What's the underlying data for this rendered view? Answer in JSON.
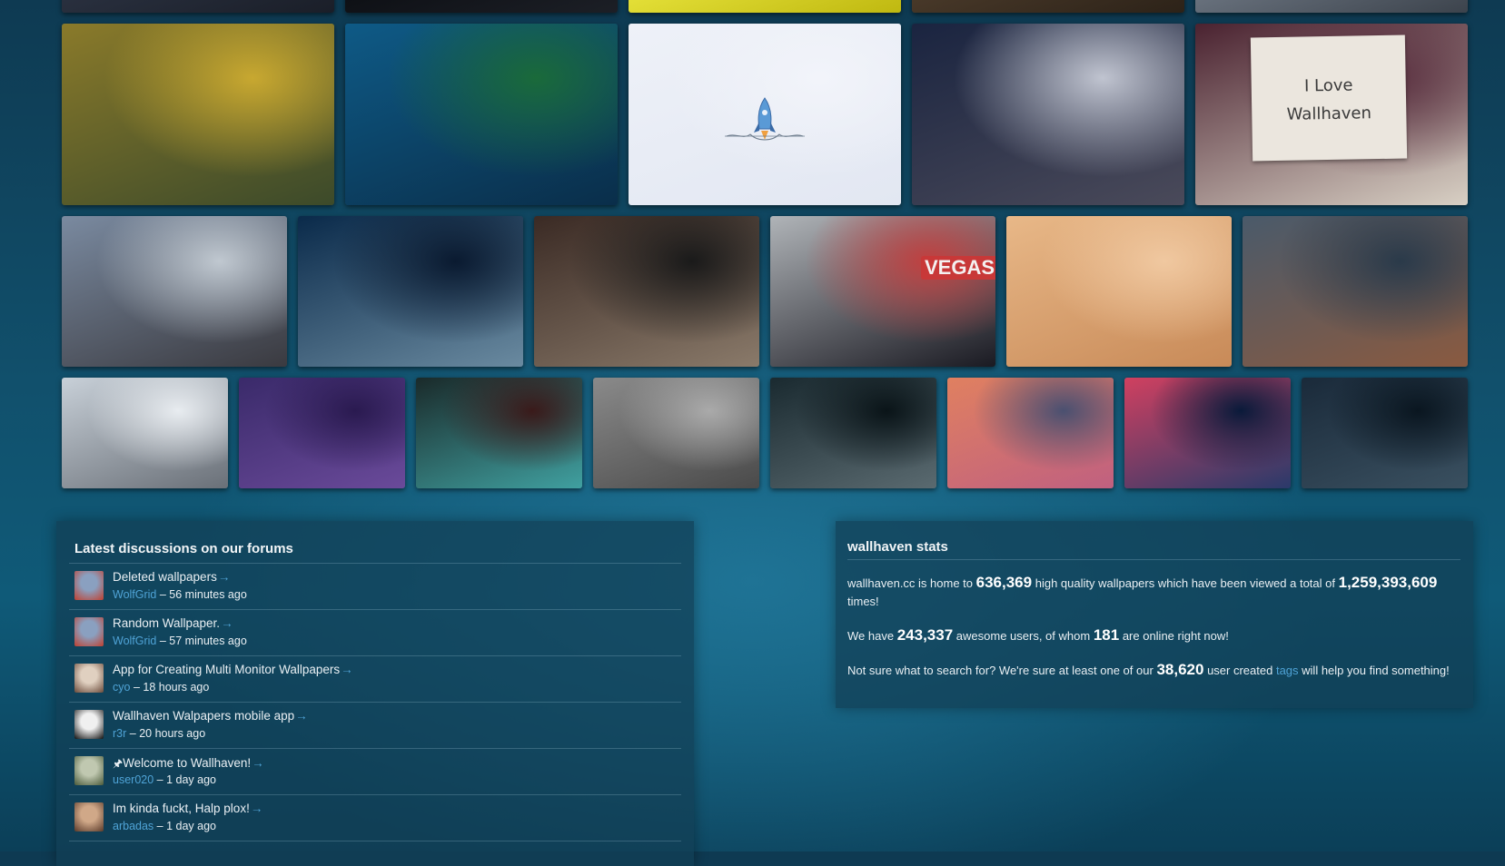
{
  "thumbnails": [
    {
      "name": "wallpaper-thumb-top-1",
      "colors": [
        "#2a3140",
        "#1a1e28"
      ]
    },
    {
      "name": "wallpaper-thumb-top-2",
      "colors": [
        "#0d0f14",
        "#1c1f26"
      ]
    },
    {
      "name": "wallpaper-thumb-top-3",
      "colors": [
        "#e6e23a",
        "#bfb810"
      ]
    },
    {
      "name": "wallpaper-thumb-top-4",
      "colors": [
        "#4a3a2a",
        "#2c2218"
      ]
    },
    {
      "name": "wallpaper-thumb-top-5",
      "colors": [
        "#6b7480",
        "#3c434c"
      ]
    },
    {
      "name": "wallpaper-thumb-golden-hands",
      "colors": [
        "#8a7a2a",
        "#3c4a2a",
        "#c8a830"
      ]
    },
    {
      "name": "wallpaper-thumb-underwater-whale",
      "colors": [
        "#0e5a86",
        "#0a2e4a",
        "#1a6a3a"
      ]
    },
    {
      "name": "wallpaper-thumb-rocket-logo",
      "colors": [
        "#eef1f8",
        "#e2e7f2",
        "#f2f4fa"
      ]
    },
    {
      "name": "wallpaper-thumb-milky-way-mountains",
      "colors": [
        "#1a2440",
        "#4a4a5a",
        "#c0c4d0"
      ]
    },
    {
      "name": "wallpaper-thumb-i-love-wallhaven",
      "colors": [
        "#4a2230",
        "#d8d0c4",
        "#5a3040"
      ]
    },
    {
      "name": "wallpaper-thumb-street-stickers",
      "colors": [
        "#7a8aa0",
        "#3a3a40",
        "#c0c8d0"
      ]
    },
    {
      "name": "wallpaper-thumb-ice-ring",
      "colors": [
        "#0a2a4a",
        "#6a8aa0",
        "#0a1a30"
      ]
    },
    {
      "name": "wallpaper-thumb-dark-forest",
      "colors": [
        "#3a2a24",
        "#8a7a6a",
        "#1a1a1a"
      ]
    },
    {
      "name": "wallpaper-thumb-vegas-car",
      "colors": [
        "#b0b4b8",
        "#1a1a22",
        "#c04040"
      ]
    },
    {
      "name": "wallpaper-thumb-desert-pyramids",
      "colors": [
        "#e8b888",
        "#c88a58",
        "#f0c8a0"
      ]
    },
    {
      "name": "wallpaper-thumb-night-bridge",
      "colors": [
        "#4a5a6a",
        "#8a5a40",
        "#2a3a4a"
      ]
    },
    {
      "name": "wallpaper-thumb-snowy-aircraft",
      "colors": [
        "#c8d0d8",
        "#6a7078",
        "#e8ecf0"
      ]
    },
    {
      "name": "wallpaper-thumb-purple-tiger",
      "colors": [
        "#3a2a6a",
        "#6a4a9a",
        "#2a1a50"
      ]
    },
    {
      "name": "wallpaper-thumb-cards-woman",
      "colors": [
        "#1a2a2a",
        "#40a0a0",
        "#3a1a1a"
      ]
    },
    {
      "name": "wallpaper-thumb-grey-creature",
      "colors": [
        "#8a8a8a",
        "#4a4a4a",
        "#aaaaaa"
      ]
    },
    {
      "name": "wallpaper-thumb-forest-giant",
      "colors": [
        "#1a2a30",
        "#5a6a70",
        "#0a1418"
      ]
    },
    {
      "name": "wallpaper-thumb-sunset-branch",
      "colors": [
        "#e08060",
        "#c06080",
        "#4a5070"
      ]
    },
    {
      "name": "wallpaper-thumb-neon-city",
      "colors": [
        "#d04060",
        "#2a3a6a",
        "#0a1a3a"
      ]
    },
    {
      "name": "wallpaper-thumb-misty-temple",
      "colors": [
        "#1a2a3a",
        "#3a5060",
        "#0a1620"
      ]
    }
  ],
  "forum": {
    "title": "Latest discussions on our forums",
    "items": [
      {
        "topic": "Deleted wallpapers",
        "user": "WolfGrid",
        "time": "– 56 minutes ago",
        "pinned": "",
        "avatar_colors": [
          "#8aa0c0",
          "#c04030"
        ]
      },
      {
        "topic": "Random Wallpaper.",
        "user": "WolfGrid",
        "time": "– 57 minutes ago",
        "pinned": "",
        "avatar_colors": [
          "#8aa0c0",
          "#c04030"
        ]
      },
      {
        "topic": "App for Creating Multi Monitor Wallpapers",
        "user": "cyo",
        "time": "– 18 hours ago",
        "pinned": "",
        "avatar_colors": [
          "#e0d0c0",
          "#6a4a3a"
        ]
      },
      {
        "topic": "Wallhaven Walpapers mobile app",
        "user": "r3r",
        "time": "– 20 hours ago",
        "pinned": "",
        "avatar_colors": [
          "#f0f0f0",
          "#101010"
        ]
      },
      {
        "topic": "Welcome to Wallhaven!",
        "user": "user020",
        "time": "– 1 day ago",
        "pinned": "🖈",
        "avatar_colors": [
          "#c0c8b0",
          "#4a5a3a"
        ]
      },
      {
        "topic": "Im kinda fuckt, Halp plox!",
        "user": "arbadas",
        "time": "– 1 day ago",
        "pinned": "",
        "avatar_colors": [
          "#d0a888",
          "#5a3a2a"
        ]
      }
    ],
    "arrow": "→"
  },
  "stats": {
    "title": "wallhaven stats",
    "line1_pre": "wallhaven.cc is home to",
    "wallpaper_count": "636,369",
    "line1_mid": "high quality wallpapers which have been viewed a total of",
    "view_count": "1,259,393,609",
    "line1_post": "times!",
    "line2_pre": "We have",
    "user_count": "243,337",
    "line2_mid": "awesome users, of whom",
    "online_count": "181",
    "line2_post": "are online right now!",
    "line3_pre": "Not sure what to search for? We're sure at least one of our",
    "tag_count": "38,620",
    "line3_mid": "user created",
    "tags_link": "tags",
    "line3_post": "will help you find something!"
  },
  "love_card": {
    "line1": "I Love",
    "line2": "Wallhaven"
  },
  "ad_text": "VEGAS"
}
